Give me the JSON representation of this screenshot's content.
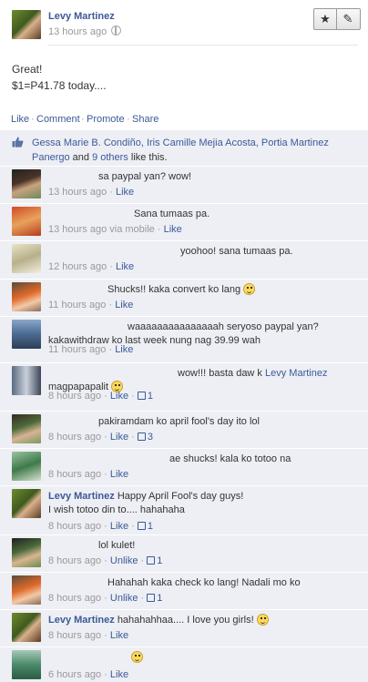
{
  "post": {
    "author": "Levy Martinez",
    "time": "13 hours ago",
    "line1": "Great!",
    "line2": "$1=P41.78 today....",
    "actions": [
      "Like",
      "Comment",
      "Promote",
      "Share"
    ],
    "likes_names": "Gessa Marie B. Condiño, Iris Camille Mejia Acosta, Portia Martinez Panergo",
    "likes_and": " and ",
    "likes_others": "9 others",
    "likes_suffix": " like this."
  },
  "comments": [
    {
      "name": "",
      "text": "sa paypal yan? wow!",
      "time": "13 hours ago",
      "action": "Like",
      "likes": ""
    },
    {
      "name": "",
      "text": "Sana tumaas pa.",
      "time": "13 hours ago via mobile",
      "action": "Like",
      "likes": ""
    },
    {
      "name": "",
      "text": "yoohoo! sana tumaas pa.",
      "time": "12 hours ago",
      "action": "Like",
      "likes": ""
    },
    {
      "name": "",
      "text": "Shucks!! kaka convert ko lang",
      "time": "11 hours ago",
      "action": "Like",
      "likes": ""
    },
    {
      "name": "",
      "text": "waaaaaaaaaaaaaaah seryoso paypal yan? kakawithdraw ko last week nung nag 39.99 wah",
      "time": "11 hours ago",
      "action": "Like",
      "likes": ""
    },
    {
      "name": "",
      "text": "wow!!! basta daw k",
      "mention": "Levy Martinez",
      "text2": "magpapapalit",
      "time": "8 hours ago",
      "action": "Like",
      "likes": "1"
    },
    {
      "name": "",
      "text": "pakiramdam ko april fool's day ito lol",
      "time": "8 hours ago",
      "action": "Like",
      "likes": "3"
    },
    {
      "name": "",
      "text": "ae shucks! kala ko totoo na",
      "time": "8 hours ago",
      "action": "Like",
      "likes": ""
    },
    {
      "name": "Levy Martinez",
      "text": "Happy April Fool's day guys!",
      "text2": "I wish totoo din to.... hahahaha",
      "time": "8 hours ago",
      "action": "Like",
      "likes": "1"
    },
    {
      "name": "",
      "text": "lol kulet!",
      "time": "8 hours ago",
      "action": "Unlike",
      "likes": "1"
    },
    {
      "name": "",
      "text": "Hahahah kaka check ko lang! Nadali mo ko",
      "time": "8 hours ago",
      "action": "Unlike",
      "likes": "1"
    },
    {
      "name": "Levy Martinez",
      "text": "hahahahhaa.... I love you girls!",
      "time": "8 hours ago",
      "action": "Like",
      "likes": ""
    },
    {
      "name": "",
      "text": "",
      "time": "6 hours ago",
      "action": "Like",
      "likes": ""
    }
  ],
  "colors": {
    "link": "#3b5998",
    "feedback_bg": "#edeff4",
    "meta": "#999999"
  },
  "icons": {
    "globe": "globe-icon",
    "star": "star-icon",
    "edit": "pencil-icon",
    "like": "thumbs-up-icon",
    "smiley": "smiley-icon"
  }
}
